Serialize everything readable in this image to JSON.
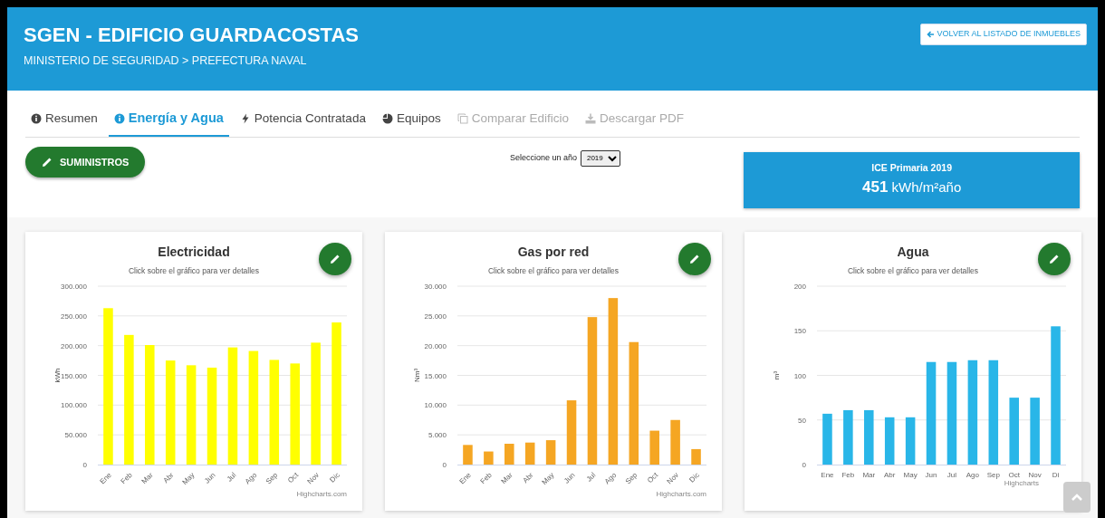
{
  "header": {
    "title": "SGEN - EDIFICIO GUARDACOSTAS",
    "breadcrumb": "MINISTERIO DE SEGURIDAD > PREFECTURA NAVAL",
    "back_button": "VOLVER AL LISTADO DE INMUEBLES"
  },
  "tabs": [
    {
      "label": "Resumen",
      "selected": false,
      "disabled": false
    },
    {
      "label": "Energía y Agua",
      "selected": true,
      "disabled": false
    },
    {
      "label": "Potencia Contratada",
      "selected": false,
      "disabled": false
    },
    {
      "label": "Equipos",
      "selected": false,
      "disabled": false
    },
    {
      "label": "Comparar Edificio",
      "selected": false,
      "disabled": true
    },
    {
      "label": "Descargar PDF",
      "selected": false,
      "disabled": true
    }
  ],
  "supplies_button": "SUMINISTROS",
  "year_select": {
    "label": "Seleccione un año",
    "value": "2019"
  },
  "indicator": {
    "title": "ICE Primaria 2019",
    "value": "451",
    "unit": "kWh/m²año"
  },
  "charts": [
    {
      "subtitle": "Click sobre el gráfico para ver detalles",
      "credit": "Highcharts.com",
      "chart_data": {
        "type": "bar",
        "title": "Electricidad",
        "ylabel": "kWh",
        "categories": [
          "Ene",
          "Feb",
          "Mar",
          "Abr",
          "May",
          "Jun",
          "Jul",
          "Ago",
          "Sep",
          "Oct",
          "Nov",
          "Dic"
        ],
        "grid": true,
        "series": [
          {
            "color": "#ffff00",
            "values": [
              263000,
              218000,
              201000,
              175000,
              167000,
              163000,
              197000,
              191000,
              176000,
              170000,
              205000,
              239000
            ]
          }
        ],
        "ylim": [
          0,
          300000
        ],
        "yticks": [
          {
            "value": 0,
            "label": "0"
          },
          {
            "value": 50000,
            "label": "50.000"
          },
          {
            "value": 100000,
            "label": "100.000"
          },
          {
            "value": 150000,
            "label": "150.000"
          },
          {
            "value": 200000,
            "label": "200.000"
          },
          {
            "value": 250000,
            "label": "250.000"
          },
          {
            "value": 300000,
            "label": "300.000"
          }
        ]
      }
    },
    {
      "subtitle": "Click sobre el gráfico para ver detalles",
      "credit": "Highcharts.com",
      "chart_data": {
        "type": "bar",
        "title": "Gas por red",
        "ylabel": "Nm³",
        "categories": [
          "Ene",
          "Feb",
          "Mar",
          "Abr",
          "May",
          "Jun",
          "Jul",
          "Ago",
          "Sep",
          "Oct",
          "Nov",
          "Dic"
        ],
        "grid": true,
        "series": [
          {
            "color": "#f5a623",
            "values": [
              3300,
              2200,
              3500,
              3700,
              4100,
              10800,
              24800,
              28000,
              20600,
              5700,
              7500,
              2600
            ]
          }
        ],
        "ylim": [
          0,
          30000
        ],
        "yticks": [
          {
            "value": 0,
            "label": "0"
          },
          {
            "value": 5000,
            "label": "5.000"
          },
          {
            "value": 10000,
            "label": "10.000"
          },
          {
            "value": 15000,
            "label": "15.000"
          },
          {
            "value": 20000,
            "label": "20.000"
          },
          {
            "value": 25000,
            "label": "25.000"
          },
          {
            "value": 30000,
            "label": "30.000"
          }
        ]
      }
    },
    {
      "subtitle": "Click sobre el gráfico para ver detalles",
      "credit": "Highcharts",
      "chart_data": {
        "type": "bar",
        "title": "Agua",
        "ylabel": "m³",
        "categories": [
          "Ene",
          "Feb",
          "Mar",
          "Abr",
          "May",
          "Jun",
          "Jul",
          "Ago",
          "Sep",
          "Oct",
          "Nov",
          "Di"
        ],
        "grid": true,
        "series": [
          {
            "color": "#29b6e8",
            "values": [
              57,
              61,
              61,
              53,
              53,
              115,
              115,
              117,
              117,
              75,
              75,
              155
            ]
          }
        ],
        "ylim": [
          0,
          200
        ],
        "yticks": [
          0,
          50,
          100,
          150,
          200
        ]
      }
    }
  ]
}
